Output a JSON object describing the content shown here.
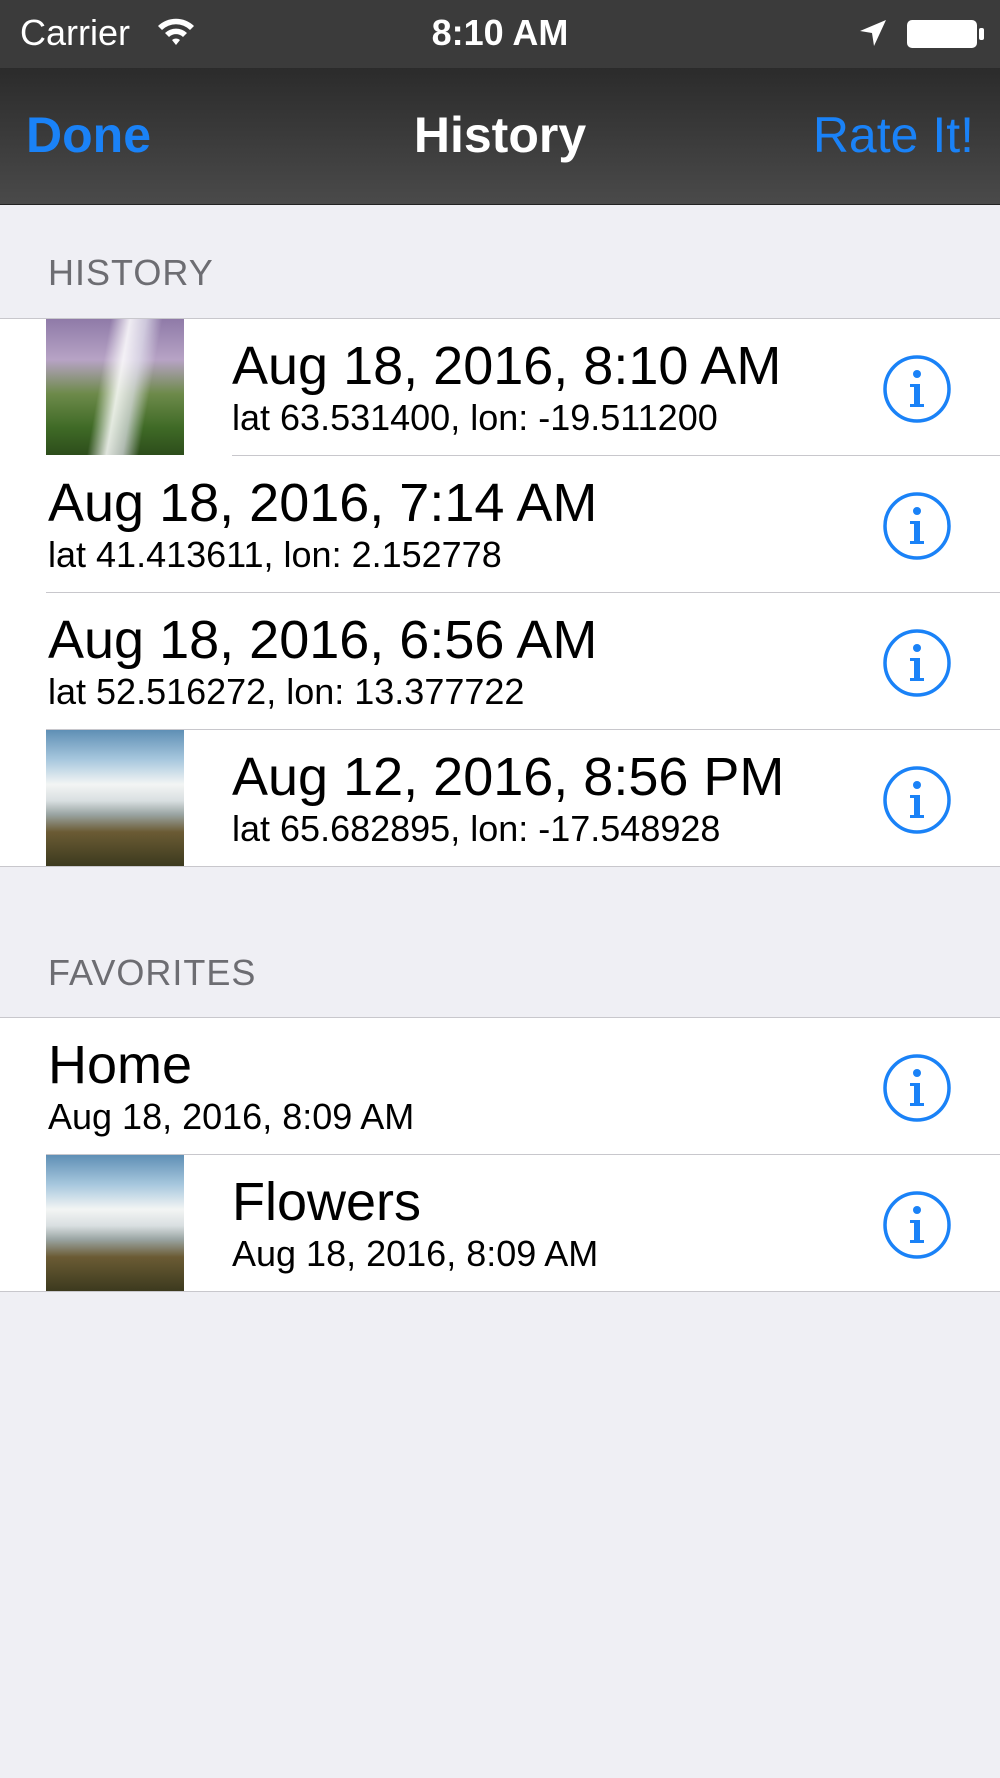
{
  "status_bar": {
    "carrier": "Carrier",
    "time": "8:10 AM",
    "icons": [
      "wifi-icon",
      "location-arrow-icon",
      "battery-icon"
    ]
  },
  "nav": {
    "left_button": "Done",
    "title": "History",
    "right_button": "Rate It!",
    "accent_color": "#1a82f7"
  },
  "history": {
    "header": "HISTORY",
    "rows": [
      {
        "primary": "Aug 18, 2016, 8:10 AM",
        "secondary": "lat 63.531400, lon: -19.511200",
        "has_thumbnail": true
      },
      {
        "primary": "Aug 18, 2016, 7:14 AM",
        "secondary": "lat 41.413611, lon: 2.152778",
        "has_thumbnail": false
      },
      {
        "primary": "Aug 18, 2016, 6:56 AM",
        "secondary": "lat 52.516272, lon: 13.377722",
        "has_thumbnail": false
      },
      {
        "primary": "Aug 12, 2016, 8:56 PM",
        "secondary": "lat 65.682895, lon: -17.548928",
        "has_thumbnail": true
      }
    ]
  },
  "favorites": {
    "header": "FAVORITES",
    "rows": [
      {
        "primary": "Home",
        "secondary": "Aug 18, 2016, 8:09 AM",
        "has_thumbnail": false
      },
      {
        "primary": "Flowers",
        "secondary": "Aug 18, 2016, 8:09 AM",
        "has_thumbnail": true
      }
    ]
  }
}
